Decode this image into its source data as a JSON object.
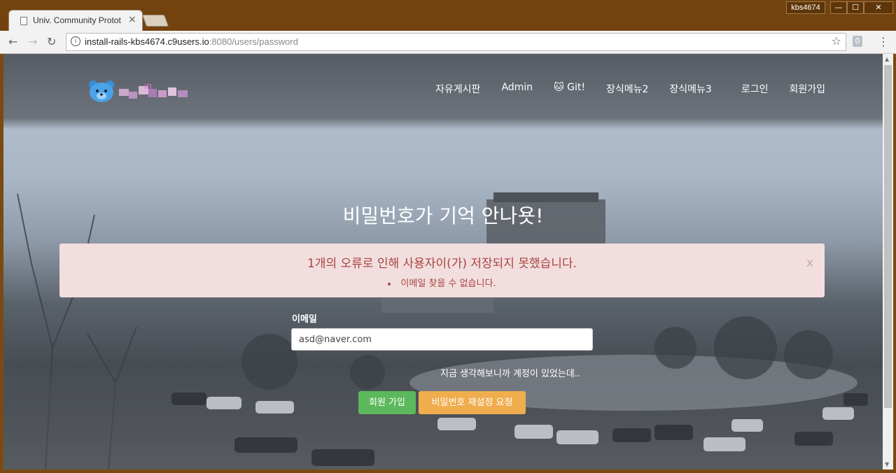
{
  "browser": {
    "tab_title": "Univ. Community Protot",
    "url_host": "install-rails-kbs4674.c9users.io",
    "url_rest": ":8080/users/password",
    "profile_name": "kbs4674",
    "extension_label": "0",
    "window_controls": {
      "minimize": "—",
      "maximize": "☐",
      "close": "✕"
    }
  },
  "navbar": {
    "links": [
      "자유게시판",
      "Admin",
      "Git!",
      "장식메뉴2",
      "장식메뉴3",
      "로그인",
      "회원가입"
    ]
  },
  "page": {
    "title": "비밀번호가 기억 안나욧!",
    "alert": {
      "heading": "1개의 오류로 인해 사용자이(가) 저장되지 못했습니다.",
      "items": [
        "이메일 찾을 수 없습니다."
      ],
      "close": "x"
    },
    "form": {
      "email_label": "이메일",
      "email_value": "asd@naver.com",
      "forgot_text": "지금 생각해보니까 계정이 있었는데..",
      "signup_button": "회원 가입",
      "reset_button": "비밀번호 재설정 요청"
    }
  },
  "colors": {
    "alert_bg": "#f2dede",
    "alert_text": "#a94442",
    "signup_button": "#5cb85c",
    "reset_button": "#f0ad4e",
    "titlebar": "#73430f"
  }
}
